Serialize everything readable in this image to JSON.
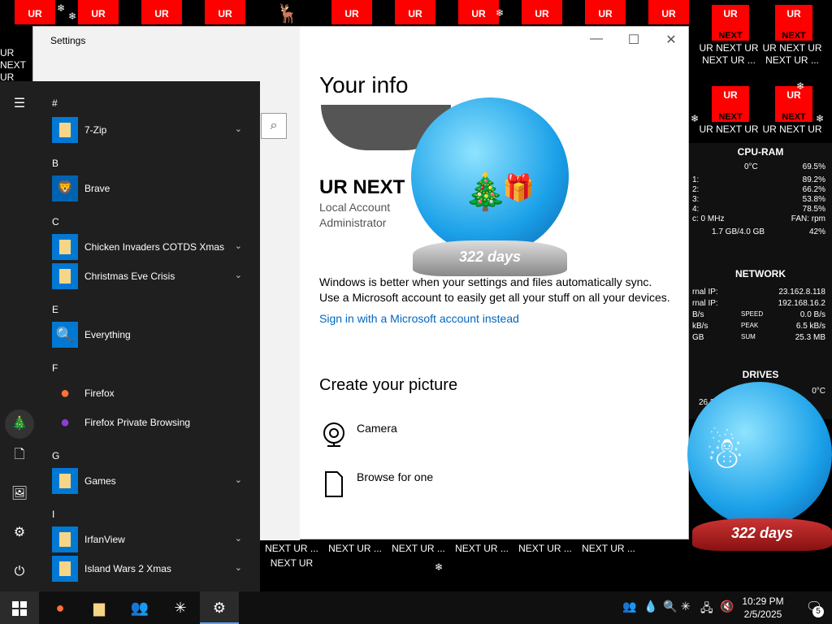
{
  "desktop": {
    "top_labels": [
      "UR",
      "UR",
      "UR",
      "UR",
      "UR",
      "UR",
      "UR",
      "UR",
      "UR",
      "UR",
      "UR",
      "UR"
    ],
    "icons": [
      {
        "tile": "UR",
        "sub": "NEXT",
        "caption": "UR NEXT UR NEXT UR ..."
      },
      {
        "tile": "UR",
        "sub": "NEXT",
        "caption": "UR NEXT UR NEXT UR ..."
      },
      {
        "tile": "UR",
        "sub": "NEXT",
        "caption": "UR NEXT UR"
      },
      {
        "tile": "UR",
        "sub": "NEXT",
        "caption": "UR NEXT UR"
      }
    ],
    "left_caption": "UR NEXT UR NEXT",
    "bottom_row": [
      "NEXT UR ...",
      "NEXT UR ...",
      "NEXT UR ...",
      "NEXT UR ...",
      "NEXT UR ...",
      "NEXT UR ...",
      "NEXT UR"
    ],
    "globe1_label": "322 days",
    "globe2_label": "322 days"
  },
  "settings": {
    "title": "Settings",
    "heading": "Your info",
    "username": "UR NEXT",
    "account_type": "Local Account",
    "role": "Administrator",
    "sync_line1": "Windows is better when your settings and files automatically sync.",
    "sync_line2": "Use a Microsoft account to easily get all your stuff on all your devices.",
    "ms_link": "Sign in with a Microsoft account instead",
    "create_heading": "Create your picture",
    "camera": "Camera",
    "browse": "Browse for one",
    "search_icon": "magnifier-icon"
  },
  "start": {
    "letters": [
      "#",
      "B",
      "C",
      "E",
      "F",
      "G",
      "I"
    ],
    "apps": [
      {
        "name": "7-Zip",
        "icon": "folder",
        "expand": true
      },
      {
        "name": "Brave",
        "icon": "brave",
        "expand": false
      },
      {
        "name": "Chicken Invaders COTDS Xmas",
        "icon": "folder",
        "expand": true
      },
      {
        "name": "Christmas Eve Crisis",
        "icon": "folder",
        "expand": true
      },
      {
        "name": "Everything",
        "icon": "everything",
        "expand": false
      },
      {
        "name": "Firefox",
        "icon": "firefox",
        "expand": false
      },
      {
        "name": "Firefox Private Browsing",
        "icon": "firefox-private",
        "expand": false
      },
      {
        "name": "Games",
        "icon": "folder",
        "expand": true
      },
      {
        "name": "IrfanView",
        "icon": "folder",
        "expand": true
      },
      {
        "name": "Island Wars 2 Xmas",
        "icon": "folder",
        "expand": true
      }
    ]
  },
  "widget": {
    "cpu_title": "CPU-RAM",
    "cpu_temp": "0°C",
    "cpu_rows": [
      {
        "l": "",
        "r": "69.5%"
      },
      {
        "l": "1:",
        "r": "89.2%"
      },
      {
        "l": "2:",
        "r": "66.2%"
      },
      {
        "l": "3:",
        "r": "53.8%"
      },
      {
        "l": "4:",
        "r": "78.5%"
      }
    ],
    "fan": "FAN: rpm",
    "cpu_mhz": "c: 0 MHz",
    "ram": "1.7 GB/4.0 GB",
    "ram_pct": "42%",
    "net_title": "NETWORK",
    "net_rows": [
      {
        "l": "rnal IP:",
        "r": "23.162.8.118"
      },
      {
        "l": "rnal IP:",
        "r": "192.168.16.2"
      },
      {
        "l": "B/s",
        "m": "SPEED",
        "r": "0.0 B/s"
      },
      {
        "l": "kB/s",
        "m": "PEAK",
        "r": "6.5 kB/s"
      },
      {
        "l": "GB",
        "m": "SUM",
        "r": "25.3 MB"
      }
    ],
    "drives_title": "DRIVES",
    "drive_temp": "0°C",
    "drive_val": "26.3"
  },
  "taskbar": {
    "time": "10:29 PM",
    "date": "2/5/2025",
    "notif_count": "5"
  }
}
